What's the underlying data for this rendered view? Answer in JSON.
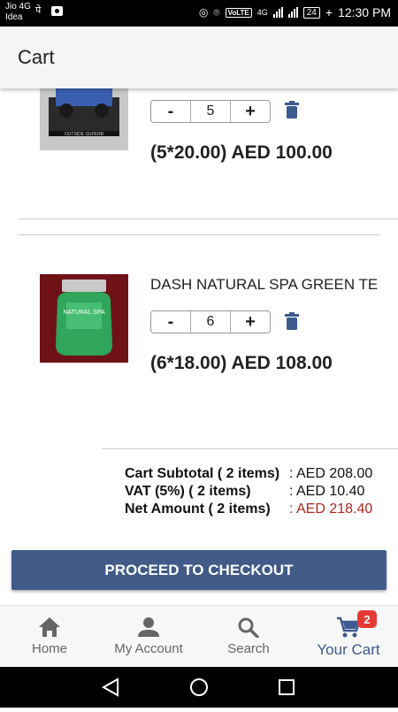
{
  "status_bar": {
    "carrier_line1": "Jio 4G",
    "carrier_line2": "Idea",
    "extra_glyph": "पे",
    "volte": "VoLTE",
    "network": "4G",
    "battery": "24",
    "time": "12:30 PM"
  },
  "app_bar": {
    "title": "Cart"
  },
  "cart": {
    "items": [
      {
        "name": "",
        "quantity": "5",
        "price_line": "(5*20.00) AED 100.00",
        "thumbnail_caption": "OUTSIDE SUPERB",
        "minus": "-",
        "plus": "+"
      },
      {
        "name": "DASH NATURAL SPA GREEN TE",
        "quantity": "6",
        "price_line": "(6*18.00) AED 108.00",
        "thumbnail_caption": "NATURAL SPA",
        "minus": "-",
        "plus": "+"
      }
    ]
  },
  "summary": {
    "subtotal_label": "Cart Subtotal ( 2 items)",
    "subtotal_value": ": AED 208.00",
    "vat_label": "VAT (5%) ( 2 items)",
    "vat_value": ": AED 10.40",
    "net_label": "Net Amount ( 2 items)",
    "net_value": ": AED 218.40"
  },
  "checkout_button": {
    "label": "PROCEED TO CHECKOUT"
  },
  "bottom_nav": {
    "tabs": [
      {
        "label": "Home",
        "icon": "home-icon"
      },
      {
        "label": "My Account",
        "icon": "account-icon"
      },
      {
        "label": "Search",
        "icon": "search-icon"
      },
      {
        "label": "Your Cart",
        "icon": "cart-icon",
        "badge": "2"
      }
    ]
  },
  "colors": {
    "accent": "#415a88",
    "active_tab": "#3d5b8f",
    "badge": "#e53935",
    "net_amount": "#b0261f"
  }
}
